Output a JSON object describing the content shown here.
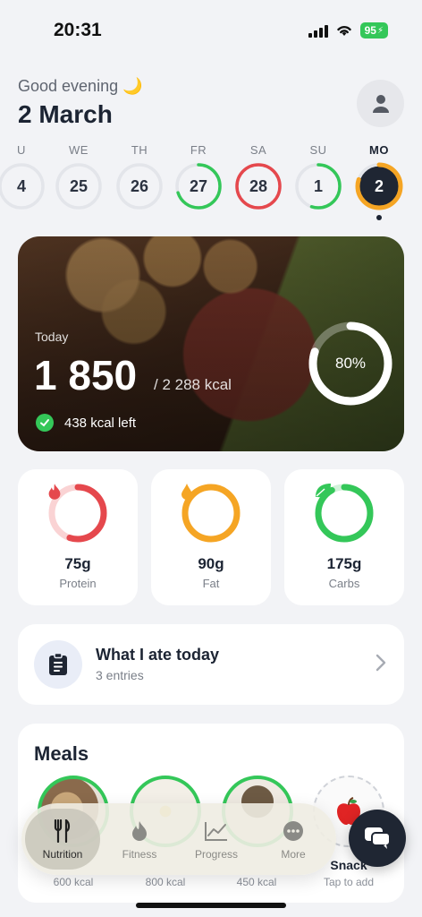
{
  "status_bar": {
    "time": "20:31",
    "battery": "95"
  },
  "header": {
    "greeting": "Good evening 🌙",
    "date": "2 March"
  },
  "week": [
    {
      "label": "U",
      "num": "4",
      "ring": "#e3e5ea",
      "fill": "none",
      "progress": 0
    },
    {
      "label": "WE",
      "num": "25",
      "ring": "#e3e5ea",
      "fill": "none",
      "progress": 0
    },
    {
      "label": "TH",
      "num": "26",
      "ring": "#e3e5ea",
      "fill": "none",
      "progress": 0
    },
    {
      "label": "FR",
      "num": "27",
      "ring": "#34c759",
      "fill": "none",
      "progress": 0.7
    },
    {
      "label": "SA",
      "num": "28",
      "ring": "#e5484d",
      "fill": "none",
      "progress": 1
    },
    {
      "label": "SU",
      "num": "1",
      "ring": "#34c759",
      "fill": "none",
      "progress": 0.55
    },
    {
      "label": "MO",
      "num": "2",
      "ring": "#f5a524",
      "fill": "#1f2633",
      "progress": 0.8
    }
  ],
  "hero": {
    "label": "Today",
    "kcal": "1 850",
    "goal": "/ 2 288 kcal",
    "left": "438 kcal left",
    "percent": "80%",
    "progress": 0.8
  },
  "macros": [
    {
      "value": "75g",
      "name": "Protein",
      "color": "#e5484d",
      "track": "#fad3d4",
      "progress": 0.55,
      "icon": "flame-icon"
    },
    {
      "value": "90g",
      "name": "Fat",
      "color": "#f5a524",
      "track": "#fde6c2",
      "progress": 1,
      "icon": "drop-icon"
    },
    {
      "value": "175g",
      "name": "Carbs",
      "color": "#34c759",
      "track": "#d2f2da",
      "progress": 0.92,
      "icon": "leaf-icon"
    }
  ],
  "ate_today": {
    "title": "What I ate today",
    "subtitle": "3 entries"
  },
  "meals": {
    "title": "Meals",
    "items": [
      {
        "kcal": "600 kcal"
      },
      {
        "kcal": "800 kcal"
      },
      {
        "kcal": "450 kcal"
      },
      {
        "label": "Snack",
        "kcal": "Tap to add"
      }
    ]
  },
  "tabs": [
    {
      "label": "Nutrition",
      "icon": "fork-knife-icon"
    },
    {
      "label": "Fitness",
      "icon": "flame-icon"
    },
    {
      "label": "Progress",
      "icon": "chart-icon"
    },
    {
      "label": "More",
      "icon": "more-icon"
    }
  ]
}
